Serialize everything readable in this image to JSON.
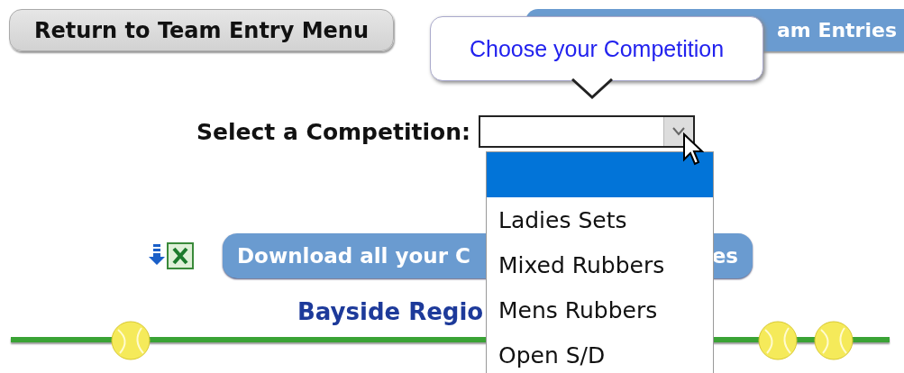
{
  "return_button": {
    "label": "Return to Team Entry Menu"
  },
  "entries_button": {
    "label": "am Entries"
  },
  "tooltip": {
    "text": "Choose your Competition"
  },
  "competition_select": {
    "label": "Select a Competition:",
    "expanded": true,
    "options": [
      {
        "selected": true
      },
      {
        "label": "Ladies Sets",
        "selected": false
      },
      {
        "label": "Mixed Rubbers",
        "selected": false
      },
      {
        "label": "Mens Rubbers",
        "selected": false
      },
      {
        "label": "Open S/D",
        "selected": false
      }
    ]
  },
  "download_button": {
    "label_start": "Download all your C",
    "label_end": "es"
  },
  "region_heading": {
    "text": "Bayside Regio"
  }
}
